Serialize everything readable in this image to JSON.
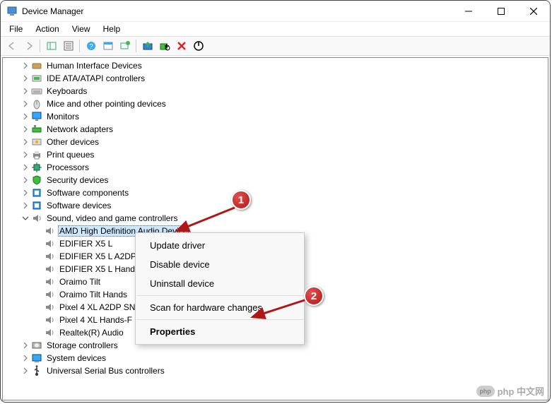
{
  "window": {
    "title": "Device Manager"
  },
  "menubar": {
    "items": [
      "File",
      "Action",
      "View",
      "Help"
    ]
  },
  "tree": {
    "nodes": [
      {
        "label": "Human Interface Devices",
        "level": 1,
        "expandable": true,
        "icon": "hid"
      },
      {
        "label": "IDE ATA/ATAPI controllers",
        "level": 1,
        "expandable": true,
        "icon": "ide"
      },
      {
        "label": "Keyboards",
        "level": 1,
        "expandable": true,
        "icon": "keyboard"
      },
      {
        "label": "Mice and other pointing devices",
        "level": 1,
        "expandable": true,
        "icon": "mouse"
      },
      {
        "label": "Monitors",
        "level": 1,
        "expandable": true,
        "icon": "monitor"
      },
      {
        "label": "Network adapters",
        "level": 1,
        "expandable": true,
        "icon": "network"
      },
      {
        "label": "Other devices",
        "level": 1,
        "expandable": true,
        "icon": "other"
      },
      {
        "label": "Print queues",
        "level": 1,
        "expandable": true,
        "icon": "printer"
      },
      {
        "label": "Processors",
        "level": 1,
        "expandable": true,
        "icon": "cpu"
      },
      {
        "label": "Security devices",
        "level": 1,
        "expandable": true,
        "icon": "security"
      },
      {
        "label": "Software components",
        "level": 1,
        "expandable": true,
        "icon": "software"
      },
      {
        "label": "Software devices",
        "level": 1,
        "expandable": true,
        "icon": "software"
      },
      {
        "label": "Sound, video and game controllers",
        "level": 1,
        "expandable": true,
        "expanded": true,
        "icon": "sound"
      },
      {
        "label": "AMD High Definition Audio Device",
        "level": 2,
        "icon": "speaker",
        "selected": true
      },
      {
        "label": "EDIFIER X5 L",
        "level": 2,
        "icon": "speaker"
      },
      {
        "label": "EDIFIER X5 L A2DP",
        "level": 2,
        "icon": "speaker",
        "truncated": "EDIFIER X5 L A2DP"
      },
      {
        "label": "EDIFIER X5 L Hand",
        "level": 2,
        "icon": "speaker",
        "truncated": "EDIFIER X5 L Hand"
      },
      {
        "label": "Oraimo Tilt",
        "level": 2,
        "icon": "speaker"
      },
      {
        "label": "Oraimo Tilt Hands",
        "level": 2,
        "icon": "speaker",
        "truncated": "Oraimo Tilt Hands"
      },
      {
        "label": "Pixel 4 XL A2DP SN",
        "level": 2,
        "icon": "speaker",
        "truncated": "Pixel 4 XL A2DP SN"
      },
      {
        "label": "Pixel 4 XL Hands-F",
        "level": 2,
        "icon": "speaker",
        "truncated": "Pixel 4 XL Hands-F"
      },
      {
        "label": "Realtek(R) Audio",
        "level": 2,
        "icon": "speaker"
      },
      {
        "label": "Storage controllers",
        "level": 1,
        "expandable": true,
        "icon": "storage"
      },
      {
        "label": "System devices",
        "level": 1,
        "expandable": true,
        "icon": "system"
      },
      {
        "label": "Universal Serial Bus controllers",
        "level": 1,
        "expandable": true,
        "icon": "usb"
      }
    ]
  },
  "context_menu": {
    "items": [
      {
        "label": "Update driver",
        "type": "item"
      },
      {
        "label": "Disable device",
        "type": "item"
      },
      {
        "label": "Uninstall device",
        "type": "item"
      },
      {
        "type": "sep"
      },
      {
        "label": "Scan for hardware changes",
        "type": "item"
      },
      {
        "type": "sep"
      },
      {
        "label": "Properties",
        "type": "item",
        "bold": true
      }
    ]
  },
  "annotations": {
    "badge1": "1",
    "badge2": "2"
  },
  "watermark": {
    "logo_text": "php",
    "text": "php 中文网"
  }
}
